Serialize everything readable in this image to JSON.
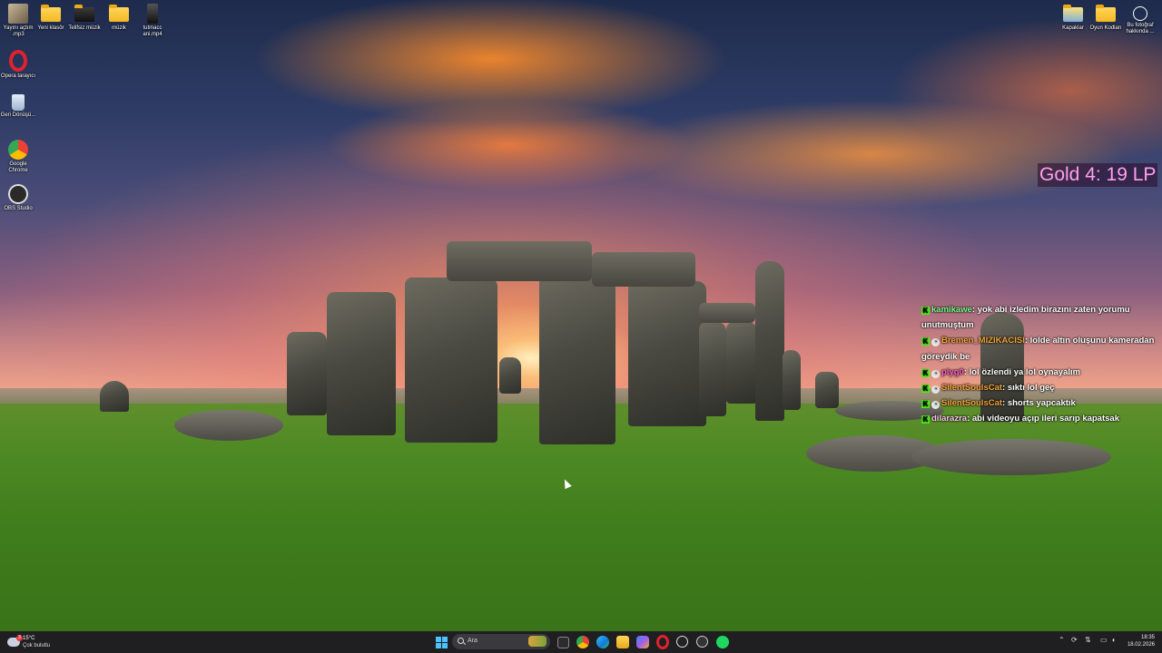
{
  "desktop": {
    "left_icons": [
      {
        "label": "Yayını açtım .mp3",
        "icon": "mp3-file-icon"
      },
      {
        "label": "Yeni klasör",
        "icon": "folder-icon"
      },
      {
        "label": "Telifsiz müzik",
        "icon": "folder-icon"
      },
      {
        "label": "müzik",
        "icon": "folder-icon"
      },
      {
        "label": "tutmacc ani.mp4",
        "icon": "video-file-icon"
      }
    ],
    "side_icons": [
      {
        "label": "Opera tarayıcı",
        "icon": "opera-icon"
      },
      {
        "label": "Geri Dönüşü...",
        "icon": "recycle-bin-icon"
      },
      {
        "label": "Google Chrome",
        "icon": "chrome-icon"
      },
      {
        "label": "OBS Studio",
        "icon": "obs-icon"
      }
    ],
    "right_icons": [
      {
        "label": "Kapaklar",
        "icon": "folder-icon"
      },
      {
        "label": "Oyun Kodları",
        "icon": "folder-icon"
      },
      {
        "label": "Bu fotoğraf hakkında ...",
        "icon": "info-camera-icon"
      }
    ]
  },
  "rank_overlay": {
    "text": "Gold 4: 19 LP",
    "color": "#ff9ff0"
  },
  "chat": {
    "messages": [
      {
        "user": "kamikawe",
        "user_color": "#7dff8a",
        "text": ": yok abi izledim birazını zaten yorumu unutmuştum",
        "badges": [
          "kick"
        ]
      },
      {
        "user": "Bremen_MIZIKACISI",
        "user_color": "#f2a33a",
        "text": ": lolde altın oluşunu kameradan göreydik be",
        "badges": [
          "kick",
          "sub"
        ]
      },
      {
        "user": "plyg0",
        "user_color": "#ff5fc4",
        "text": ": lol özlendi ya lol oynayalım",
        "badges": [
          "kick",
          "sub"
        ]
      },
      {
        "user": "SilentSoulsCat",
        "user_color": "#f2a33a",
        "text": ": sıktı lol geç",
        "badges": [
          "kick",
          "sub"
        ]
      },
      {
        "user": "SilentSoulsCat",
        "user_color": "#f2a33a",
        "text": ": shorts yapcaktık",
        "badges": [
          "kick",
          "sub"
        ]
      },
      {
        "user": "dilarazra",
        "user_color": "#ffc8f0",
        "text": ": abi videoyu açıp ileri sarıp kapatsak",
        "badges": [
          "kick"
        ]
      }
    ]
  },
  "taskbar": {
    "weather": {
      "temp": "15°C",
      "condition": "Çok bulutlu",
      "alert_count": "3"
    },
    "search_placeholder": "Ara",
    "pinned": [
      "start-icon",
      "task-view-icon",
      "chrome-icon",
      "edge-icon",
      "file-explorer-icon",
      "copilot-icon",
      "opera-icon",
      "obs-icon",
      "media-player-icon",
      "spotify-icon"
    ],
    "clock": {
      "time": "18:35",
      "date": "18.02.2026"
    },
    "tray": [
      "chevron-up-icon",
      "sync-icon",
      "network-icon",
      "microphone-icon",
      "monitor-icon",
      "wifi-icon",
      "volume-icon"
    ]
  }
}
